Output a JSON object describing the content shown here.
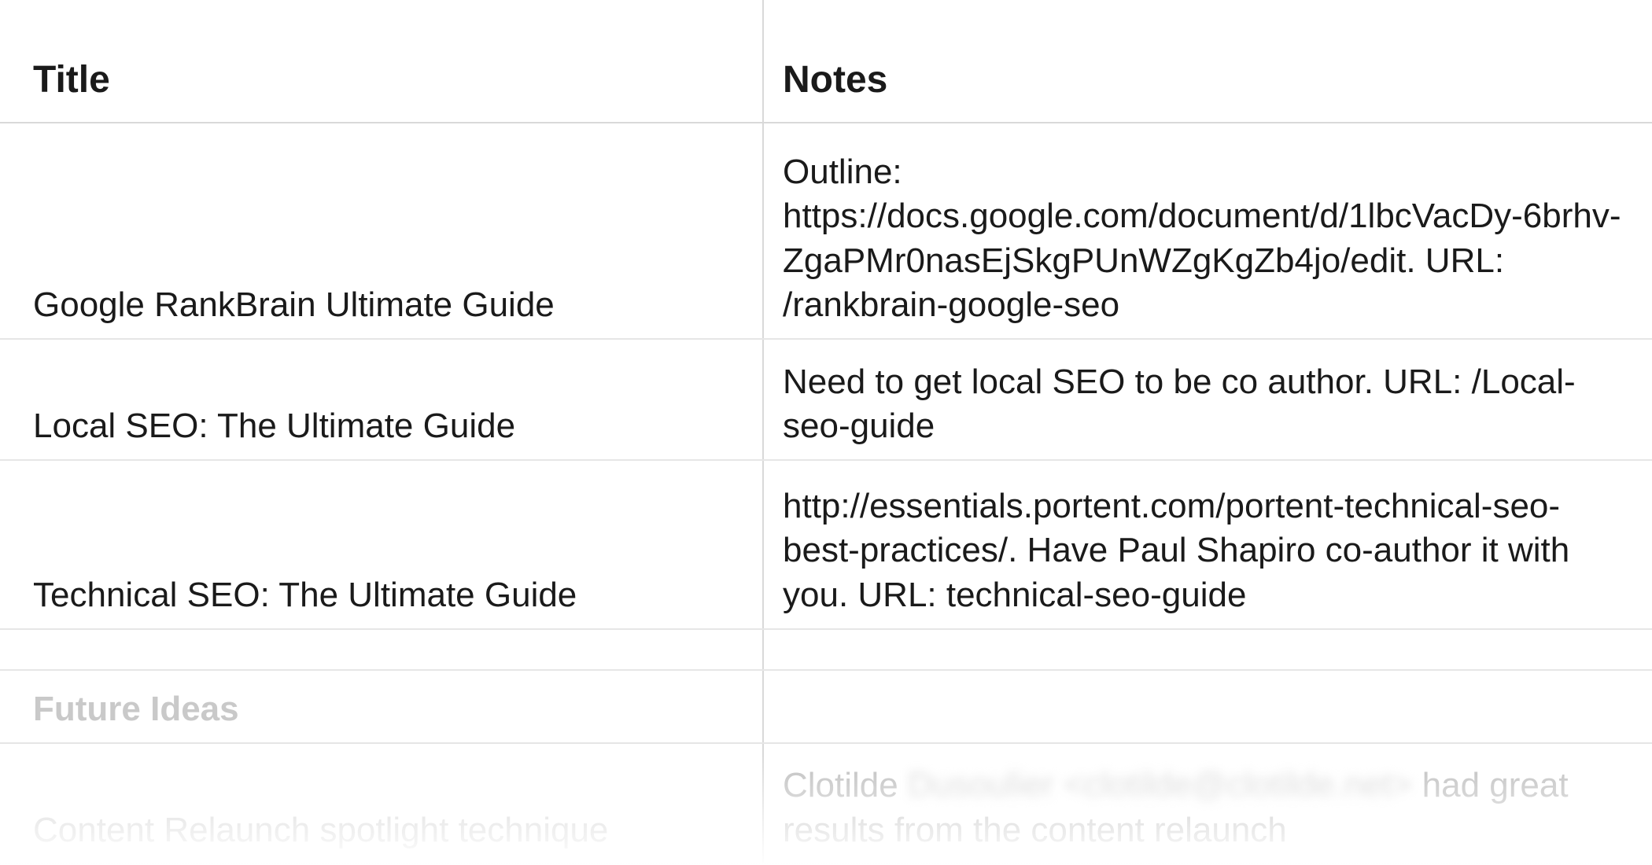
{
  "headers": {
    "title": "Title",
    "notes": "Notes"
  },
  "rows": [
    {
      "title": "Google RankBrain Ultimate Guide",
      "notes": "Outline: https://docs.google.com/document/d/1lbcVacDy-6brhv-ZgaPMr0nasEjSkgPUnWZgKgZb4jo/edit. URL: /rankbrain-google-seo"
    },
    {
      "title": "Local SEO: The Ultimate Guide",
      "notes": "Need to get local SEO to be co author. URL: /Local-seo-guide"
    },
    {
      "title": "Technical SEO: The Ultimate Guide",
      "notes": "http://essentials.portent.com/portent-technical-seo-best-practices/. Have Paul Shapiro co-author it with you. URL: technical-seo-guide"
    }
  ],
  "section_heading": "Future Ideas",
  "future_rows": [
    {
      "title": "Content Relaunch spotlight technique",
      "notes_pre": "Clotilde ",
      "notes_blurred": "Dusoulier <clotilde@clotilde.net>",
      "notes_post": " had great results from the content relaunch"
    }
  ]
}
